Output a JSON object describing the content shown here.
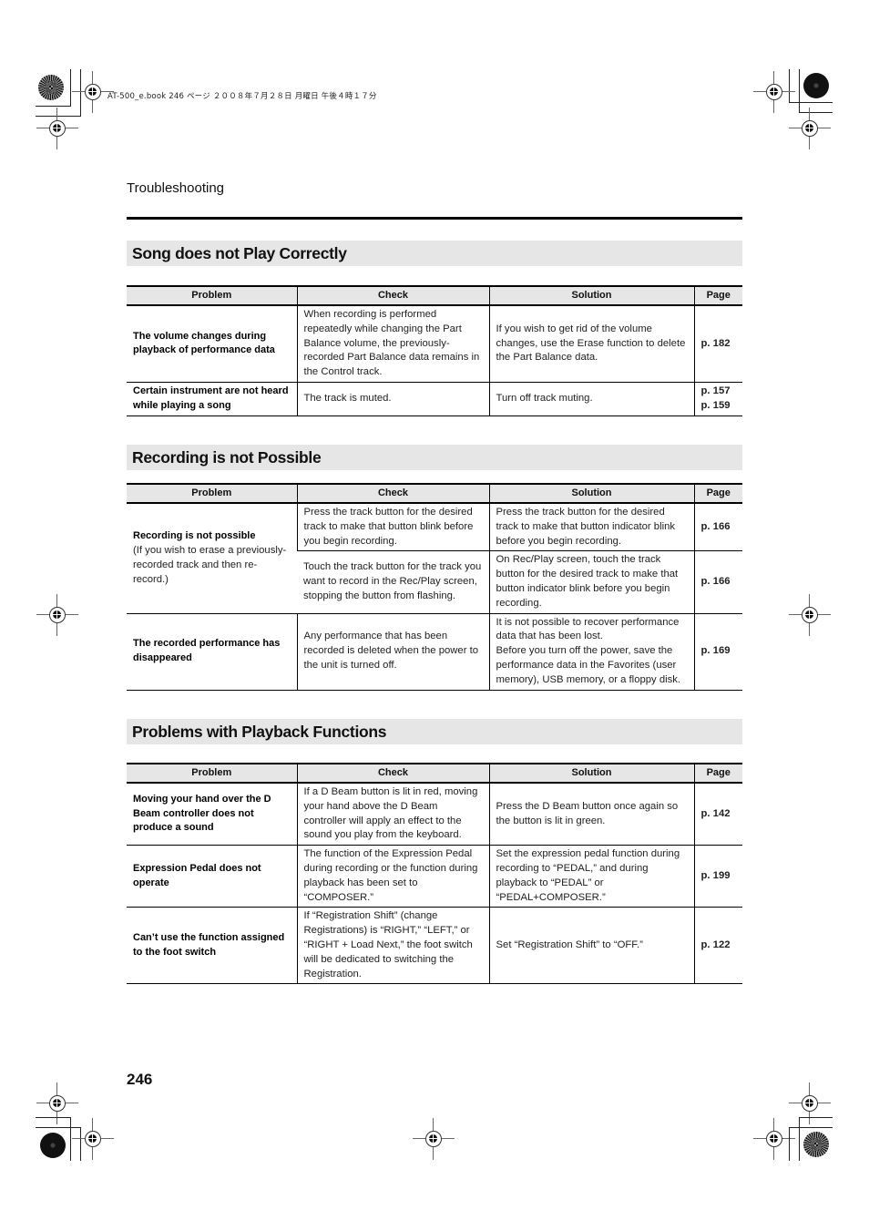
{
  "slug": "AT-500_e.book  246 ページ  ２００８年７月２８日  月曜日  午後４時１７分",
  "running_head": "Troubleshooting",
  "folio": "246",
  "headers": {
    "problem": "Problem",
    "check": "Check",
    "solution": "Solution",
    "page": "Page"
  },
  "sections": [
    {
      "title": "Song does not Play Correctly",
      "rows": [
        {
          "problem": "The volume changes during playback of performance data",
          "problem_note": "",
          "check": "When recording is performed repeatedly while changing the Part Balance volume, the previously-recorded Part Balance data remains in the Control track.",
          "solution": "If you wish to get rid of the volume changes, use the Erase function to delete the Part Balance data.",
          "page": "p. 182"
        },
        {
          "problem": "Certain instrument are not heard while playing a song",
          "problem_note": "",
          "check": "The track is muted.",
          "solution": "Turn off track muting.",
          "page": "p. 157\np. 159"
        }
      ]
    },
    {
      "title": "Recording is not Possible",
      "rows": [
        {
          "problem": "Recording is not possible",
          "problem_note": "(If you wish to erase a previously-recorded track and then re-record.)",
          "check": "Press the track button for the desired track to make that button blink before you begin recording.",
          "solution": "Press the track button for the desired track to make that button indicator blink before you begin recording.",
          "page": "p. 166"
        },
        {
          "problem": "",
          "problem_note": "",
          "check": "Touch the track button for the track you want to record in the Rec/Play screen, stopping the button from flashing.",
          "solution": "On Rec/Play screen, touch the track button for the desired track to make that button indicator blink before you begin recording.",
          "page": "p. 166"
        },
        {
          "problem": "The recorded performance has disappeared",
          "problem_note": "",
          "check": "Any performance that has been recorded is deleted when the power to the unit is turned off.",
          "solution": "It is not possible to recover performance data that has been lost.\nBefore you turn off the power, save the performance data in the Favorites (user memory), USB memory, or a floppy disk.",
          "page": "p. 169"
        }
      ]
    },
    {
      "title": "Problems with Playback Functions",
      "rows": [
        {
          "problem": "Moving your hand over the D Beam controller does not produce a sound",
          "problem_note": "",
          "check": "If a D Beam button is lit in red, moving your hand above the D Beam controller will apply an effect to the sound you play from the keyboard.",
          "solution": "Press the D Beam button once again so the button is lit in green.",
          "page": "p. 142"
        },
        {
          "problem": "Expression Pedal does not operate",
          "problem_note": "",
          "check": "The function of the Expression Pedal during recording or the function during playback has been set to “COMPOSER.”",
          "solution": "Set the expression pedal function during recording to “PEDAL,” and during playback to “PEDAL” or “PEDAL+COMPOSER.”",
          "page": "p. 199"
        },
        {
          "problem": "Can’t use the function assigned to the foot switch",
          "problem_note": "",
          "check": "If “Registration Shift” (change Registrations) is “RIGHT,” “LEFT,” or “RIGHT + Load Next,” the foot switch will be dedicated to switching the Registration.",
          "solution": "Set “Registration Shift” to “OFF.”",
          "page": "p. 122"
        }
      ]
    }
  ]
}
